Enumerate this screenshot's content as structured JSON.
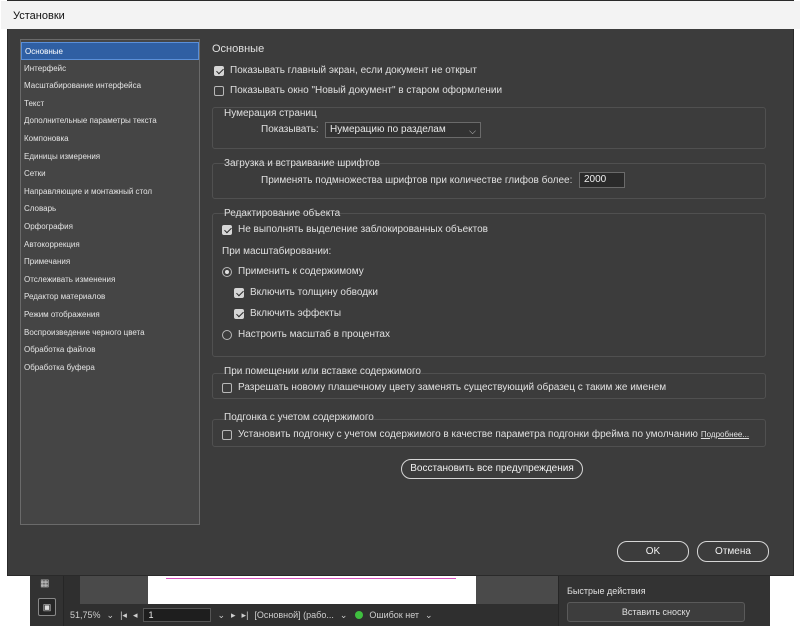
{
  "window": {
    "title": "Установки"
  },
  "sidebar": {
    "items": [
      {
        "label": "Основные",
        "active": true
      },
      {
        "label": "Интерфейс"
      },
      {
        "label": "Масштабирование интерфейса"
      },
      {
        "label": "Текст"
      },
      {
        "label": "Дополнительные параметры текста"
      },
      {
        "label": "Компоновка"
      },
      {
        "label": "Единицы измерения"
      },
      {
        "label": "Сетки"
      },
      {
        "label": "Направляющие и монтажный стол"
      },
      {
        "label": "Словарь"
      },
      {
        "label": "Орфография"
      },
      {
        "label": "Автокоррекция"
      },
      {
        "label": "Примечания"
      },
      {
        "label": "Отслеживать изменения"
      },
      {
        "label": "Редактор материалов"
      },
      {
        "label": "Режим отображения"
      },
      {
        "label": "Воспроизведение черного цвета"
      },
      {
        "label": "Обработка файлов"
      },
      {
        "label": "Обработка буфера"
      }
    ]
  },
  "main": {
    "title": "Основные",
    "show_home": {
      "label": "Показывать главный экран, если документ не открыт",
      "checked": true
    },
    "show_new_doc": {
      "label": "Показывать окно \"Новый документ\" в старом оформлении",
      "checked": false
    },
    "page_numbering": {
      "title": "Нумерация страниц",
      "show_label": "Показывать:",
      "show_value": "Нумерацию по разделам"
    },
    "fonts": {
      "title": "Загрузка и встраивание шрифтов",
      "subset_label": "Применять подмножества шрифтов при количестве глифов более:",
      "subset_value": "2000"
    },
    "object_editing": {
      "title": "Редактирование объекта",
      "no_select_locked": {
        "label": "Не выполнять выделение заблокированных объектов",
        "checked": true
      },
      "scaling_label": "При масштабировании:",
      "apply_to_content": {
        "label": "Применить к содержимому",
        "selected": true
      },
      "include_stroke": {
        "label": "Включить толщину обводки",
        "checked": true
      },
      "include_effects": {
        "label": "Включить эффекты",
        "checked": true
      },
      "scale_percent": {
        "label": "Настроить масштаб в процентах",
        "selected": false
      }
    },
    "paste": {
      "title": "При помещении или вставке содержимого",
      "allow_swatch": {
        "label": "Разрешать новому плашечному цвету заменять существующий образец с таким же именем",
        "checked": false
      }
    },
    "content_fit": {
      "title": "Подгонка с учетом содержимого",
      "set_default": {
        "label": "Установить подгонку с учетом содержимого в качестве параметра подгонки фрейма по умолчанию",
        "checked": false
      },
      "more_link": "Подробнее..."
    },
    "reset_warnings": "Восстановить все предупреждения"
  },
  "buttons": {
    "ok": "OK",
    "cancel": "Отмена"
  },
  "background_app": {
    "zoom": "51,75%",
    "page": "1",
    "master": "[Основной] (рабо...",
    "errors": "Ошибок нет",
    "quick_actions": "Быстрые действия",
    "insert_footnote": "Вставить сноску"
  }
}
